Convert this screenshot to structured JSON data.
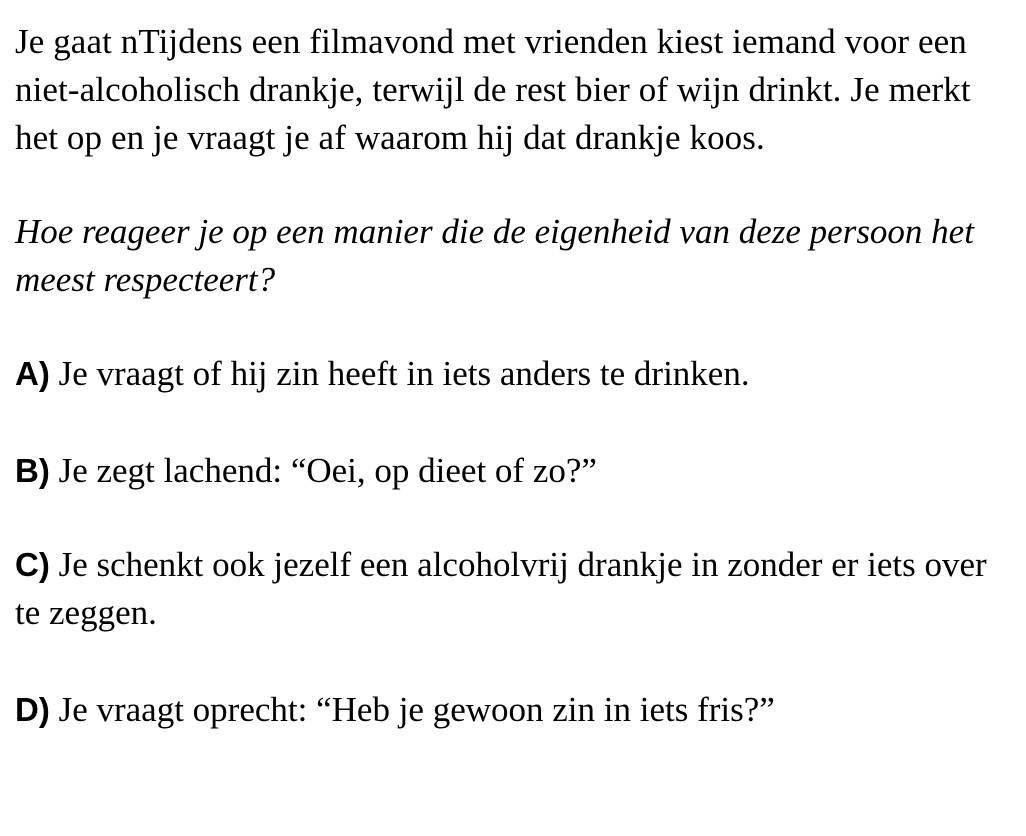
{
  "scenario": "Je gaat nTijdens een filmavond met vrienden kiest iemand voor een niet-alcoholisch drankje, terwijl de rest bier of wijn drinkt. Je merkt het op en je vraagt je af waarom hij dat drankje koos.",
  "question": " Hoe reageer je op een manier die de eigenheid van deze persoon het meest respecteert?",
  "options": [
    {
      "letter": "A)",
      "text": " Je vraagt of hij zin heeft in iets anders te drinken."
    },
    {
      "letter": "B)",
      "text": " Je zegt lachend: “Oei, op dieet of zo?”"
    },
    {
      "letter": "C)",
      "text": " Je schenkt ook jezelf een alcoholvrij drankje in zonder er iets over te zeggen."
    },
    {
      "letter": "D)",
      "text": " Je vraagt oprecht: “Heb je gewoon zin in iets fris?”"
    }
  ]
}
